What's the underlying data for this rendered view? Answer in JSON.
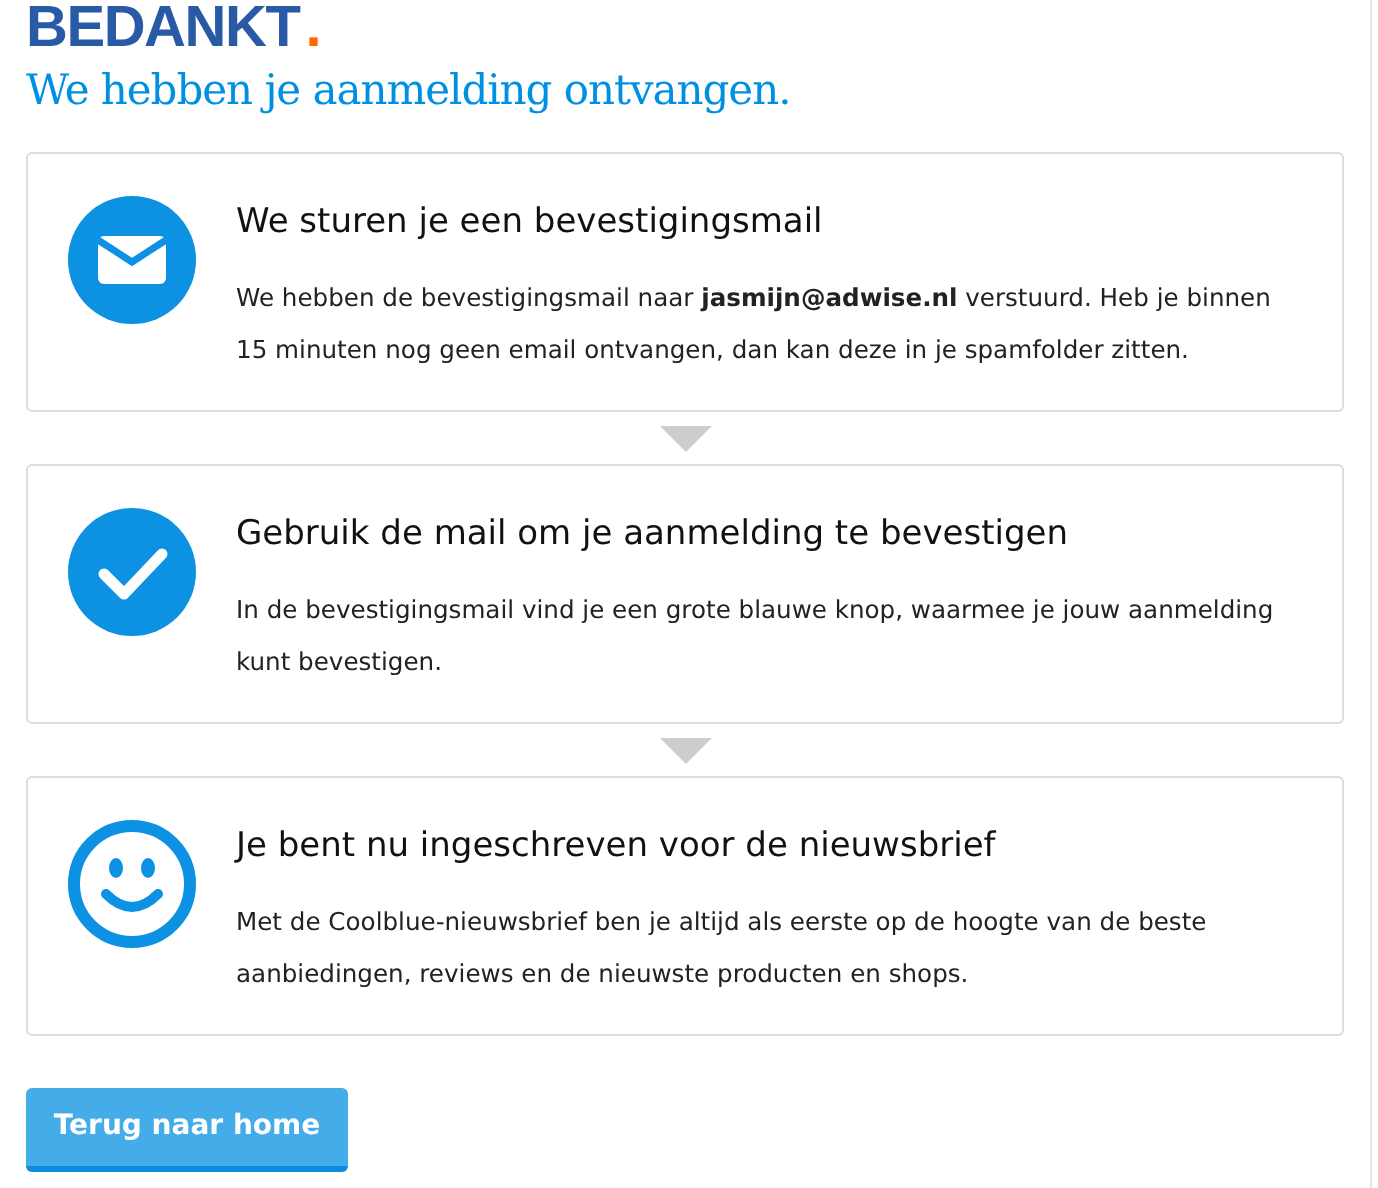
{
  "heading": {
    "title": "BEDANKT",
    "dot": ".",
    "subtitle": "We hebben je aanmelding ontvangen."
  },
  "steps": [
    {
      "kind": "mail",
      "title": "We sturen je een bevestigingsmail",
      "text": "We hebben de bevestigingsmail naar **jasmijn@adwise.nl** verstuurd. Heb je binnen 15 minuten nog geen email ontvangen, dan kan deze in je spamfolder zitten."
    },
    {
      "kind": "check",
      "title": "Gebruik de mail om je aanmelding te bevestigen",
      "text": "In de bevestigingsmail vind je een grote blauwe knop, waarmee je jouw aanmelding kunt bevestigen."
    },
    {
      "kind": "smiley",
      "title": "Je bent nu ingeschreven voor de nieuwsbrief",
      "text": "Met de Coolblue-nieuwsbrief ben je altijd als eerste op de hoogte van de beste aanbiedingen, reviews en de nieuwste producten en shops."
    }
  ],
  "button": {
    "label": "Terug naar home"
  }
}
